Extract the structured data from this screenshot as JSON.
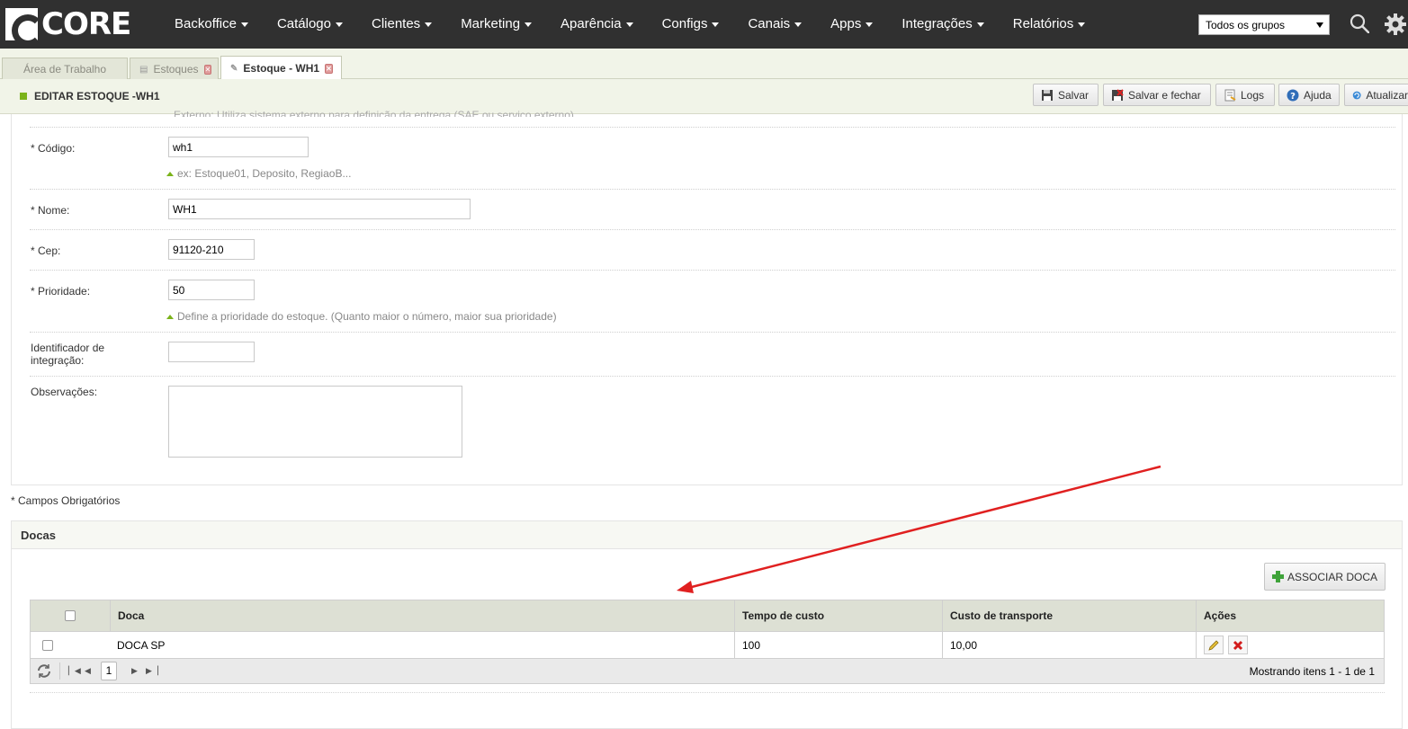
{
  "brand": {
    "name": "CORE"
  },
  "nav": {
    "items": [
      {
        "label": "Backoffice"
      },
      {
        "label": "Catálogo"
      },
      {
        "label": "Clientes"
      },
      {
        "label": "Marketing"
      },
      {
        "label": "Aparência"
      },
      {
        "label": "Configs"
      },
      {
        "label": "Canais"
      },
      {
        "label": "Apps"
      },
      {
        "label": "Integrações"
      },
      {
        "label": "Relatórios"
      }
    ],
    "group_select": {
      "value": "Todos os grupos"
    },
    "icons": [
      "search-icon",
      "gear-icon"
    ]
  },
  "tabs": [
    {
      "label": "Área de Trabalho"
    },
    {
      "label": "Estoques"
    },
    {
      "label": "Estoque - WH1"
    }
  ],
  "header": {
    "title": "EDITAR ESTOQUE -WH1",
    "buttons": {
      "save": "Salvar",
      "save_close": "Salvar e fechar",
      "logs": "Logs",
      "help": "Ajuda",
      "refresh": "Atualizar"
    }
  },
  "form": {
    "clipped_hint": "Externo: Utiliza sistema externo para definição da entrega (SAE ou serviço externo)",
    "codigo": {
      "label": "* Código:",
      "value": "wh1",
      "hint": "ex: Estoque01, Deposito, RegiaoB..."
    },
    "nome": {
      "label": "* Nome:",
      "value": "WH1"
    },
    "cep": {
      "label": "* Cep:",
      "value": "91120-210"
    },
    "prioridade": {
      "label": "* Prioridade:",
      "value": "50",
      "hint": "Define a prioridade do estoque. (Quanto maior o número, maior sua prioridade)"
    },
    "identificador": {
      "label_line1": "Identificador de",
      "label_line2": "integração:",
      "value": ""
    },
    "observacoes": {
      "label": "Observações:",
      "value": ""
    },
    "required_note": "* Campos Obrigatórios"
  },
  "docas": {
    "title": "Docas",
    "associate_button": "ASSOCIAR DOCA",
    "columns": [
      "Doca",
      "Tempo de custo",
      "Custo de transporte",
      "Ações"
    ],
    "rows": [
      {
        "doca": "DOCA SP",
        "tempo": "100",
        "custo": "10,00"
      }
    ],
    "pager": {
      "page": "1",
      "info": "Mostrando itens 1 - 1 de 1"
    }
  },
  "colors": {
    "nav_bg": "#303030",
    "accent": "#7bb31a",
    "arrow": "#e02020"
  }
}
